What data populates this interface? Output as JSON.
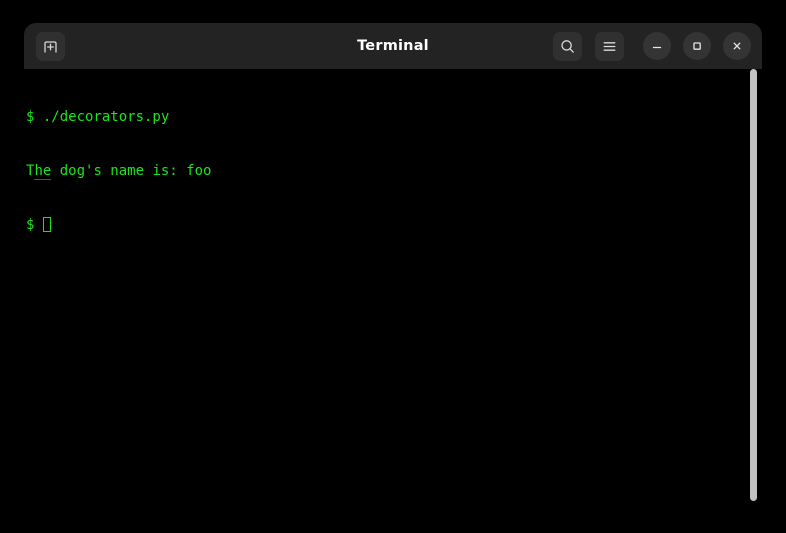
{
  "window": {
    "title": "Terminal",
    "titlebar_color": "#232323",
    "background_color": "#000000"
  },
  "titlebar": {
    "new_tab": {
      "icon": "new-tab-icon",
      "tooltip": "New Tab"
    },
    "search": {
      "icon": "search-icon",
      "tooltip": "Find"
    },
    "menu": {
      "icon": "hamburger-menu-icon",
      "tooltip": "Main Menu"
    },
    "minimize": {
      "icon": "minimize-icon",
      "tooltip": "Minimize"
    },
    "maximize": {
      "icon": "maximize-icon",
      "tooltip": "Maximize"
    },
    "close": {
      "icon": "close-icon",
      "tooltip": "Close"
    }
  },
  "terminal": {
    "foreground_color": "#19e619",
    "background_color": "#000000",
    "lines": [
      {
        "prompt": "$ ",
        "text": "./decorators.py"
      },
      {
        "prompt": "",
        "text": "The dog's name is: foo"
      },
      {
        "prompt": "$ ",
        "text": ""
      }
    ],
    "line1_prompt": "$ ",
    "line1_command": "./decorators.py",
    "line2_output_a": "T",
    "line2_output_b": "he",
    "line2_output_c": " dog's name is: foo",
    "line3_prompt": "$ ",
    "cursor": "block-cursor-hollow"
  },
  "scrollbar": {
    "name": "vertical-scrollbar",
    "thumb_color": "#c2c2c2"
  }
}
